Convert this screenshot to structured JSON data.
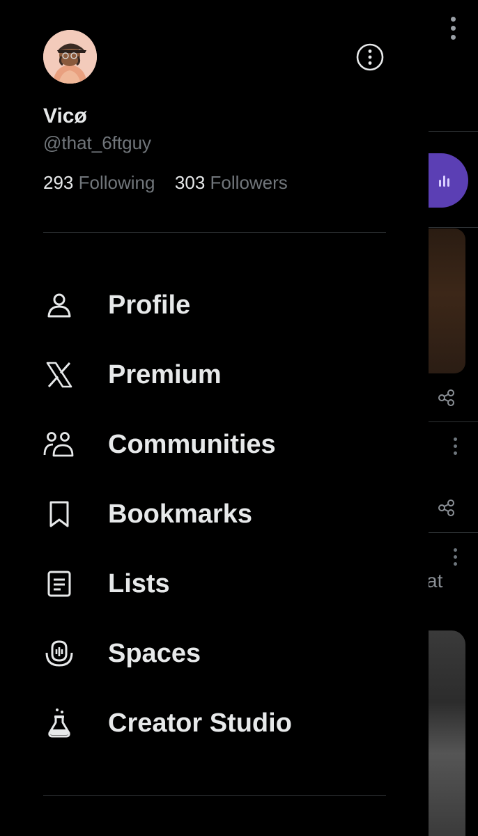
{
  "profile": {
    "display_name": "Vicø",
    "handle": "@that_6ftguy",
    "following_count": "293",
    "following_label": "Following",
    "followers_count": "303",
    "followers_label": "Followers"
  },
  "menu": {
    "items": [
      {
        "label": "Profile",
        "icon": "person-icon"
      },
      {
        "label": "Premium",
        "icon": "x-logo-icon"
      },
      {
        "label": "Communities",
        "icon": "communities-icon"
      },
      {
        "label": "Bookmarks",
        "icon": "bookmark-icon"
      },
      {
        "label": "Lists",
        "icon": "list-icon"
      },
      {
        "label": "Spaces",
        "icon": "spaces-mic-icon"
      },
      {
        "label": "Creator Studio",
        "icon": "flask-icon"
      }
    ]
  },
  "feed": {
    "snippet_text": "at"
  },
  "colors": {
    "background": "#000000",
    "primary_text": "#e7e9ea",
    "secondary_text": "#71767b",
    "divider": "#2f3336",
    "spaces_purple": "#5b3fb4"
  }
}
